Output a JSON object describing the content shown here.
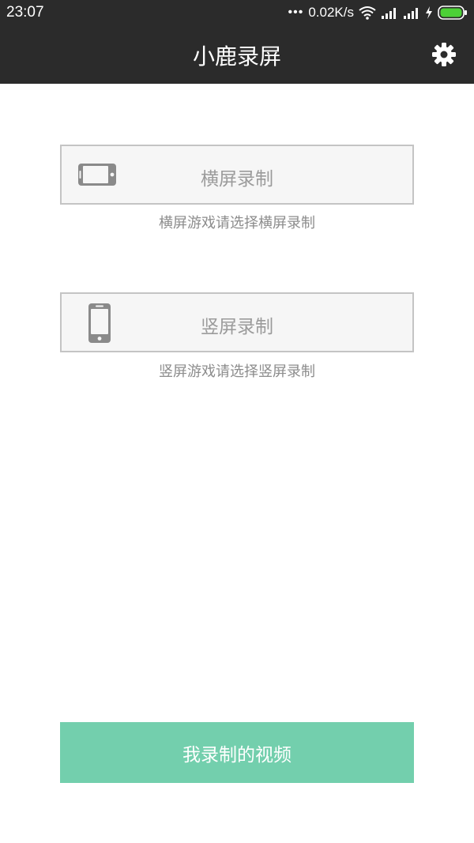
{
  "status_bar": {
    "time": "23:07",
    "net_speed": "0.02K/s",
    "icons": [
      "more-dots-icon",
      "wifi-icon",
      "signal-icon",
      "signal-icon",
      "charging-icon",
      "battery-icon"
    ],
    "battery_color": "#4cd137"
  },
  "header": {
    "title": "小鹿录屏",
    "settings_icon": "gear-icon"
  },
  "landscape": {
    "label": "横屏录制",
    "hint": "横屏游戏请选择横屏录制",
    "icon": "phone-landscape-icon"
  },
  "portrait": {
    "label": "竖屏录制",
    "hint": "竖屏游戏请选择竖屏录制",
    "icon": "phone-portrait-icon"
  },
  "footer": {
    "my_videos_label": "我录制的视频",
    "accent_color": "#73cfad"
  }
}
